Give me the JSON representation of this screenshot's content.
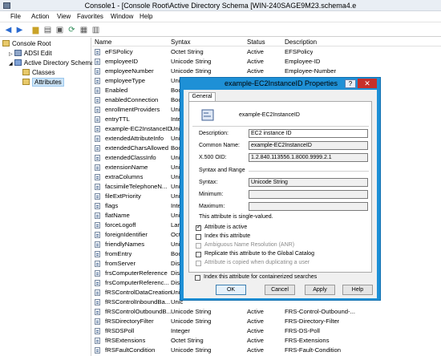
{
  "window": {
    "title": "Console1 - [Console Root\\Active Directory Schema [WIN-240SAGE9M23.schema4.e"
  },
  "menu": [
    "File",
    "Action",
    "View",
    "Favorites",
    "Window",
    "Help"
  ],
  "toolbar": [
    "back-icon",
    "forward-icon",
    "folder-up-icon",
    "properties-icon",
    "refresh-icon",
    "export-icon",
    "help-icon",
    "view-icon"
  ],
  "tree": {
    "root": "Console Root",
    "items": [
      "ADSI Edit",
      "Active Directory Schema",
      "Classes",
      "Attributes"
    ]
  },
  "columns": [
    "Name",
    "Syntax",
    "Status",
    "Description"
  ],
  "rows": [
    [
      "eFSPolicy",
      "Octet String",
      "Active",
      "EFSPolicy"
    ],
    [
      "employeeID",
      "Unicode String",
      "Active",
      "Employee-ID"
    ],
    [
      "employeeNumber",
      "Unicode String",
      "Active",
      "Employee-Number"
    ],
    [
      "employeeType",
      "Unic",
      "",
      ""
    ],
    [
      "Enabled",
      "Boo",
      "",
      ""
    ],
    [
      "enabledConnection",
      "Boo",
      "",
      ""
    ],
    [
      "enrollmentProviders",
      "Unic",
      "",
      ""
    ],
    [
      "entryTTL",
      "Inte",
      "",
      ""
    ],
    [
      "example-EC2InstanceID",
      "Unic",
      "",
      ""
    ],
    [
      "extendedAttributeInfo",
      "Unic",
      "",
      ""
    ],
    [
      "extendedCharsAllowed",
      "Boo",
      "",
      ""
    ],
    [
      "extendedClassInfo",
      "Unic",
      "",
      ""
    ],
    [
      "extensionName",
      "Unic",
      "",
      ""
    ],
    [
      "extraColumns",
      "Unic",
      "",
      ""
    ],
    [
      "facsimileTelephoneN...",
      "Unic",
      "",
      ""
    ],
    [
      "fileExtPriority",
      "Unic",
      "",
      ""
    ],
    [
      "flags",
      "Inte",
      "",
      ""
    ],
    [
      "flatName",
      "Unic",
      "",
      ""
    ],
    [
      "forceLogoff",
      "Lar",
      "",
      ""
    ],
    [
      "foreignIdentifier",
      "Oct",
      "",
      ""
    ],
    [
      "friendlyNames",
      "Unic",
      "",
      ""
    ],
    [
      "fromEntry",
      "Boo",
      "",
      ""
    ],
    [
      "fromServer",
      "Dist",
      "",
      ""
    ],
    [
      "frsComputerReference",
      "Dist",
      "",
      ""
    ],
    [
      "frsComputerReferenc...",
      "Dist",
      "",
      ""
    ],
    [
      "fRSControlDataCreation",
      "Unic",
      "",
      ""
    ],
    [
      "fRSControlInboundBa...",
      "Unic",
      "",
      ""
    ],
    [
      "fRSControlOutboundB...",
      "Unicode String",
      "Active",
      "FRS-Control-Outbound-..."
    ],
    [
      "fRSDirectoryFilter",
      "Unicode String",
      "Active",
      "FRS-Directory-Filter"
    ],
    [
      "fRSDSPoll",
      "Integer",
      "Active",
      "FRS-DS-Poll"
    ],
    [
      "fRSExtensions",
      "Octet String",
      "Active",
      "FRS-Extensions"
    ],
    [
      "fRSFaultCondition",
      "Unicode String",
      "Active",
      "FRS-Fault-Condition"
    ]
  ],
  "dialog": {
    "title": "example-EC2InstanceID Properties",
    "help_label": "?",
    "close_label": "✕",
    "tab": "General",
    "attr_name": "example-EC2InstanceID",
    "description_label": "Description:",
    "description_value": "EC2 instance ID",
    "common_name_label": "Common Name:",
    "common_name_value": "example-EC2InstanceID",
    "oid_label": "X.500 OID:",
    "oid_value": "1.2.840.113556.1.8000.9999.2.1",
    "syntax_group": "Syntax and Range",
    "syntax_label": "Syntax:",
    "syntax_value": "Unicode String",
    "minimum_label": "Minimum:",
    "minimum_value": "",
    "maximum_label": "Maximum:",
    "maximum_value": "",
    "single_valued_note": "This attribute is single-valued.",
    "checkboxes": [
      {
        "label": "Attribute is active",
        "checked": true,
        "enabled": true
      },
      {
        "label": "Index this attribute",
        "checked": false,
        "enabled": true
      },
      {
        "label": "Ambiguous Name Resolution (ANR)",
        "checked": false,
        "enabled": false
      },
      {
        "label": "Replicate this attribute to the Global Catalog",
        "checked": false,
        "enabled": true
      },
      {
        "label": "Attribute is copied when duplicating a user",
        "checked": false,
        "enabled": false
      },
      {
        "label": "Index this attribute for containerized searches",
        "checked": false,
        "enabled": true
      }
    ],
    "buttons": [
      "OK",
      "Cancel",
      "Apply",
      "Help"
    ]
  }
}
